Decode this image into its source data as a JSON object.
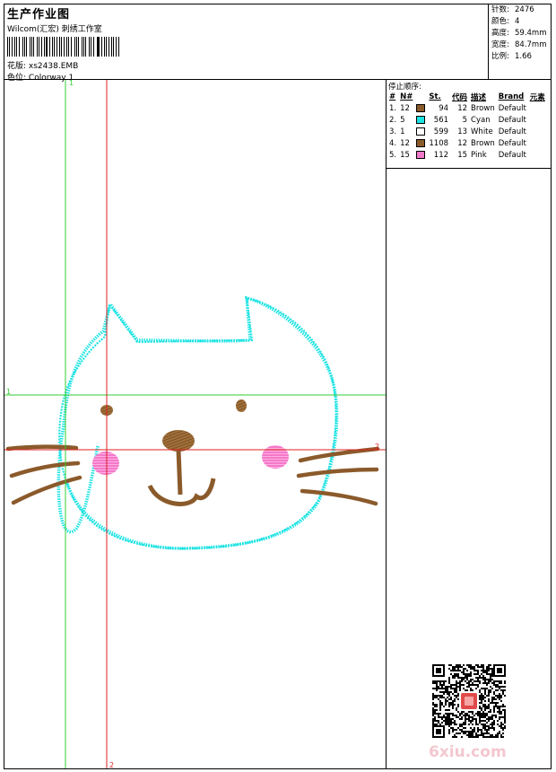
{
  "header": {
    "title": "生产作业图",
    "company": "Wilcom(汇宏) 刺绣工作室",
    "design_label": "花版:",
    "design_value": "xs2438.EMB",
    "colorway_label": "色位:",
    "colorway_value": "Colorway 1"
  },
  "stats": [
    {
      "label": "针数:",
      "value": "2476"
    },
    {
      "label": "颜色:",
      "value": "4"
    },
    {
      "label": "高度:",
      "value": "59.4mm"
    },
    {
      "label": "宽度:",
      "value": "84.7mm"
    },
    {
      "label": "比例:",
      "value": "1.66"
    }
  ],
  "stop_sequence": {
    "title": "停止顺序:",
    "headers": [
      "#",
      "N#",
      "",
      "St.",
      "代码",
      "描述",
      "Brand",
      "元素"
    ],
    "rows": [
      {
        "index": "1.",
        "needle": "12",
        "color": "#8b5a2b",
        "stitches": "94",
        "code": "12",
        "desc": "Brown",
        "brand": "Default"
      },
      {
        "index": "2.",
        "needle": "5",
        "color": "#1fe3e3",
        "stitches": "561",
        "code": "5",
        "desc": "Cyan",
        "brand": "Default"
      },
      {
        "index": "3.",
        "needle": "1",
        "color": "#ffffff",
        "stitches": "599",
        "code": "13",
        "desc": "White",
        "brand": "Default"
      },
      {
        "index": "4.",
        "needle": "12",
        "color": "#8b5a2b",
        "stitches": "1108",
        "code": "12",
        "desc": "Brown",
        "brand": "Default"
      },
      {
        "index": "5.",
        "needle": "15",
        "color": "#f07ac8",
        "stitches": "112",
        "code": "15",
        "desc": "Pink",
        "brand": "Default"
      }
    ]
  },
  "canvas": {
    "guide_labels": {
      "v_green": "1",
      "h_green": "1",
      "h_red": "2",
      "v_red": "2"
    },
    "colors": {
      "green_guide": "#33cc33",
      "red_guide": "#dd2222",
      "outline": "#1fe3e3",
      "brown": "#8b5a2b",
      "pink": "#f07ac8"
    }
  },
  "watermark": "6xiu.com"
}
